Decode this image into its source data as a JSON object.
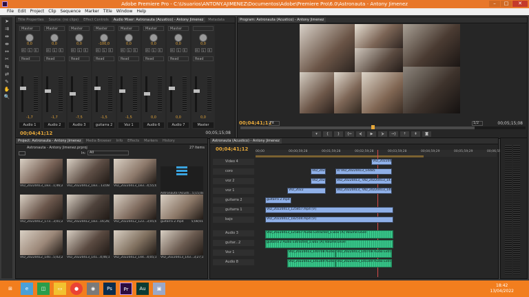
{
  "window": {
    "title": "Adobe Premiere Pro - C:\\Usuarios\\ANTONY.AJIMENEZ\\Documentos\\Adobe\\Premiere Pro\\6.0\\Astronauta - Antony Jimenez"
  },
  "menu": [
    "File",
    "Edit",
    "Project",
    "Clip",
    "Sequence",
    "Marker",
    "Title",
    "Window",
    "Help"
  ],
  "mixer": {
    "tabs": [
      "Title Properties",
      "Source: (no clips)",
      "Effect Controls",
      "Audio Mixer: Astronauta (Acustico) - Antony Jimenez",
      "Metadata"
    ],
    "active_tab": "Audio Mixer: Astronauta (Acustico) - Antony Jimenez",
    "channels": [
      {
        "name": "Audio 1",
        "mode": "Master",
        "pan": "0,0",
        "read": "Read",
        "db": "-1,7"
      },
      {
        "name": "Audio 2",
        "mode": "Master",
        "pan": "0,0",
        "read": "Read",
        "db": "-1,7"
      },
      {
        "name": "Audio 3",
        "mode": "Master",
        "pan": "0,0",
        "read": "Read",
        "db": "-7,5"
      },
      {
        "name": "guitarra 2",
        "mode": "Master",
        "pan": "-100,0",
        "read": "Read",
        "db": "-1,5"
      },
      {
        "name": "Voz 1",
        "mode": "Master",
        "pan": "0,0",
        "read": "Read",
        "db": "-1,5"
      },
      {
        "name": "Audio 6",
        "mode": "Master",
        "pan": "0,0",
        "read": "Read",
        "db": "0,0"
      },
      {
        "name": "Audio 7",
        "mode": "Master",
        "pan": "0,0",
        "read": "Read",
        "db": "0,0"
      },
      {
        "name": "Master",
        "mode": "",
        "pan": "0,0",
        "read": "Read",
        "db": "0,0"
      }
    ],
    "timecode_left": "00;04;41;12",
    "timecode_right": "00;05;15;08"
  },
  "program": {
    "tab": "Program: Astronauta (Acustico) - Antony Jimenez",
    "timecode_left": "00;04;41;12",
    "fit": "Fit",
    "zoom": "1/2",
    "timecode_right": "00;05;15;08"
  },
  "project": {
    "tabs": [
      "Project: Astronauta - Antony Jimenez",
      "Media Browser",
      "Info",
      "Effects",
      "Markers",
      "History"
    ],
    "file": "Astronauta - Antony Jimenez.prproj",
    "item_count": "27 Items",
    "in_label": "In:",
    "in_value": "All",
    "items": [
      {
        "name": "VID_20220413_183...",
        "dur": "1;46;29"
      },
      {
        "name": "VID_20220412_183...",
        "dur": "13;08"
      },
      {
        "name": "VID_20220413_183...",
        "dur": "4;55;03"
      },
      {
        "name": "Astronauta (Acusti...",
        "dur": "5;15;08"
      },
      {
        "name": "VID_20220412_173...",
        "dur": "3;01;20"
      },
      {
        "name": "VID_20220412_183...",
        "dur": "16;26;02"
      },
      {
        "name": "VID_20220412_123...",
        "dur": "3;05;05"
      },
      {
        "name": "guitarra 2.mp4",
        "dur": "5;08;01"
      },
      {
        "name": "VID_20220412_140...",
        "dur": "5;02;28"
      },
      {
        "name": "VID_20220413_141...",
        "dur": "4;46;12"
      },
      {
        "name": "VID_20220412_144...",
        "dur": "4;05;18"
      },
      {
        "name": "VID_20220413_143...",
        "dur": "3;27;19"
      }
    ]
  },
  "timeline": {
    "tab": "Astronauta (Acustico) - Antony Jimenez",
    "timecode": "00;04;41;12",
    "ruler": [
      "00;00",
      "00;00;59;28",
      "00;01;59;28",
      "00;02;59;28",
      "00;03;59;28",
      "00;04;59;29",
      "00;05;59;29",
      "00;06;59;29"
    ],
    "tracks": [
      {
        "name": "Video 4",
        "clips": [
          {
            "label": "VID_2022041",
            "type": "v"
          }
        ]
      },
      {
        "name": "coro",
        "clips": [
          {
            "label": "VID_2022",
            "type": "v"
          },
          {
            "label": "V/ VID_20220413_14485",
            "type": "v"
          }
        ]
      },
      {
        "name": "voz 2",
        "clips": [
          {
            "label": "VID_2022",
            "type": "v"
          },
          {
            "label": "VID_20220413_ VID_20220413_141348.m",
            "type": "v"
          }
        ]
      },
      {
        "name": "voz 1",
        "clips": [
          {
            "label": "VID_2022",
            "type": "v"
          },
          {
            "label": "VID_20220413_ VID_20220413_140708.m",
            "type": "v"
          }
        ]
      },
      {
        "name": "guitarra 2",
        "clips": [
          {
            "label": "guitarra 2.mp4 [V]",
            "type": "v"
          }
        ]
      },
      {
        "name": "guitarra 1",
        "clips": [
          {
            "label": "VID_20220413_125857.mp4 [V]",
            "type": "v"
          }
        ]
      },
      {
        "name": "bajo",
        "clips": [
          {
            "label": "VID_20220412_182504.mp4 [V]",
            "type": "v"
          }
        ]
      },
      {
        "name": "Audio 3",
        "clips": [
          {
            "label": "VID_20220413_125857 Audio Extracted_1.wav [A] Volume:Level",
            "type": "a"
          }
        ]
      },
      {
        "name": "guitar...2",
        "clips": [
          {
            "label": "guitarra 2 Audio Extracted_1.wav [A] Volume:Level",
            "type": "a"
          }
        ]
      },
      {
        "name": "Voz 1",
        "clips": [
          {
            "label": "VID_20220413_140708 Audio",
            "type": "a"
          },
          {
            "label": "VID_20220413_140708 Audio Extracte",
            "type": "a"
          }
        ]
      },
      {
        "name": "Audio 8",
        "clips": [
          {
            "label": "VID_20220413_141349 Audio",
            "type": "a"
          },
          {
            "label": "VID_20220413_141349 Audio Extracte",
            "type": "a"
          }
        ]
      }
    ]
  },
  "taskbar": {
    "apps": [
      "Ps",
      "Pr",
      "Au"
    ],
    "time": "18:42",
    "date": "13/04/2022"
  }
}
